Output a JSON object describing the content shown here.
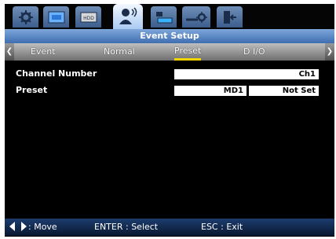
{
  "icon_bar": {
    "icons": [
      {
        "name": "settings-gear-icon"
      },
      {
        "name": "display-icon"
      },
      {
        "name": "hdd-icon",
        "text": "HDD"
      },
      {
        "name": "event-person-icon"
      },
      {
        "name": "network-icon"
      },
      {
        "name": "system-gear-icon"
      },
      {
        "name": "exit-icon"
      }
    ],
    "active_index": 3
  },
  "title": "Event Setup",
  "tabs": [
    {
      "label": "Event"
    },
    {
      "label": "Normal"
    },
    {
      "label": "Preset",
      "active": true
    },
    {
      "label": "D I/O"
    }
  ],
  "form": {
    "channel_number": {
      "label": "Channel Number",
      "value": "Ch1"
    },
    "preset": {
      "label": "Preset",
      "value1": "MD1",
      "value2": "Not Set"
    }
  },
  "bottom": {
    "move": ": Move",
    "enter": "ENTER : Select",
    "esc": "ESC : Exit"
  },
  "colors": {
    "accent_underline": "#f1d400",
    "title_bar": "#5a86c6",
    "background": "#000000"
  }
}
